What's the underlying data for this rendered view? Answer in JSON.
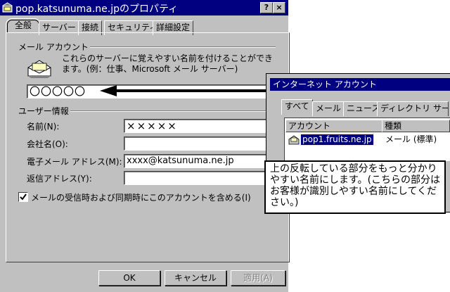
{
  "window": {
    "title": "pop.katsunuma.ne.jpのプロパティ",
    "help_button": "?",
    "close_button": "×"
  },
  "tabs": [
    {
      "label": "全般"
    },
    {
      "label": "サーバー"
    },
    {
      "label": "接続"
    },
    {
      "label": "セキュリティ"
    },
    {
      "label": "詳細設定"
    }
  ],
  "mail_account": {
    "group_label": "メール アカウント",
    "description": "これらのサーバーに覚えやすい名前を付けることができます。(例：仕事、Microsoft メール サーバー)",
    "name_value": "〇〇〇〇〇"
  },
  "user_info": {
    "group_label": "ユーザー情報",
    "name_label": "名前(N):",
    "name_value": "×××××",
    "company_label": "会社名(O):",
    "company_value": "",
    "email_label": "電子メール アドレス(M):",
    "email_value": "xxxx@katsunuma.ne.jp",
    "reply_label": "返信アドレス(Y):",
    "reply_value": ""
  },
  "include_checkbox": {
    "label": "メールの受信時および同期時にこのアカウントを含める(I)",
    "checked": true
  },
  "buttons": {
    "ok": "OK",
    "cancel": "キャンセル",
    "apply": "適用(A)"
  },
  "internet_accounts": {
    "title": "インターネット アカウント",
    "tabs": [
      {
        "label": "すべて"
      },
      {
        "label": "メール"
      },
      {
        "label": "ニュース"
      },
      {
        "label": "ディレクトリ サービス"
      }
    ],
    "columns": [
      "アカウント",
      "種類"
    ],
    "rows": [
      {
        "account": "pop1.fruits.ne.jp",
        "type": "メール (標準)"
      }
    ]
  },
  "callout": {
    "text": "上の反転している部分をもっと分かりやすい名前にします。(こちらの部分はお客様が識別しやすい名前にしてください。)"
  },
  "colors": {
    "titlebar": "#000080",
    "face": "#c0c0c0",
    "selection": "#000080"
  }
}
